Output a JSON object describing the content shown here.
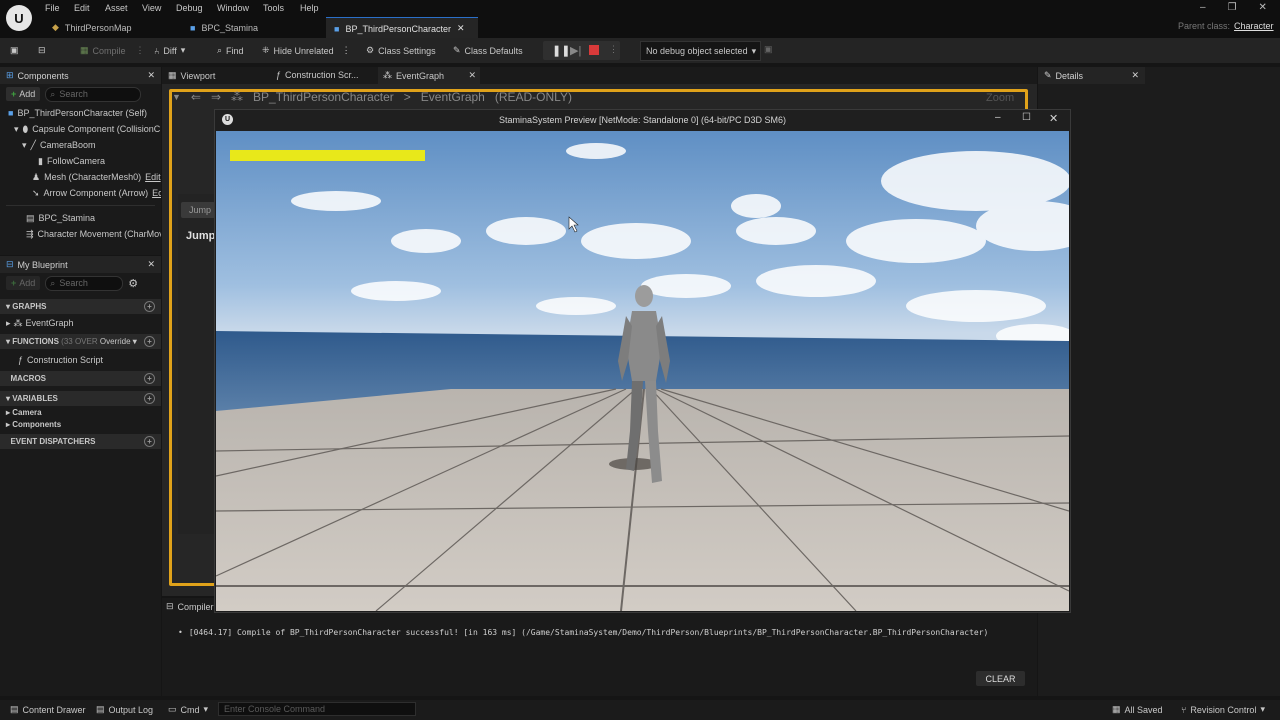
{
  "menu": {
    "file": "File",
    "edit": "Edit",
    "asset": "Asset",
    "view": "View",
    "debug": "Debug",
    "window": "Window",
    "tools": "Tools",
    "help": "Help"
  },
  "tabs": {
    "tab1": "ThirdPersonMap",
    "tab2": "BPC_Stamina",
    "tab3": "BP_ThirdPersonCharacter"
  },
  "parent_class": {
    "label": "Parent class:",
    "value": "Character"
  },
  "toolbar": {
    "compile": "Compile",
    "diff": "Diff",
    "find": "Find",
    "hide_unrelated": "Hide Unrelated",
    "class_settings": "Class Settings",
    "class_defaults": "Class Defaults",
    "debug_object": "No debug object selected"
  },
  "components": {
    "title": "Components",
    "add": "Add",
    "search_placeholder": "Search",
    "items": [
      "BP_ThirdPersonCharacter (Self)",
      "Capsule Component (CollisionC",
      "CameraBoom",
      "FollowCamera",
      "Mesh (CharacterMesh0)",
      "Arrow Component (Arrow)",
      "BPC_Stamina",
      "Character Movement (CharMov"
    ],
    "edit_suffix": "Edit",
    "edit_suffix2": "Ec"
  },
  "my_blueprint": {
    "title": "My Blueprint",
    "add": "Add",
    "search_placeholder": "Search",
    "graphs": "GRAPHS",
    "event_graph": "EventGraph",
    "functions": "FUNCTIONS",
    "functions_count": "(33 OVER",
    "override": "Override",
    "construction_script": "Construction Script",
    "macros": "MACROS",
    "variables": "VARIABLES",
    "camera": "Camera",
    "components": "Components",
    "event_dispatchers": "EVENT DISPATCHERS"
  },
  "center_tabs": {
    "viewport": "Viewport",
    "construction": "Construction Scr...",
    "event_graph": "EventGraph"
  },
  "graph": {
    "breadcrumb_root": "BP_ThirdPersonCharacter",
    "breadcrumb_sep": ">",
    "breadcrumb_leaf": "EventGraph",
    "readonly": "(READ-ONLY)",
    "zoom": "Zoom",
    "jump_node": "Jump",
    "jump_label": "Jump"
  },
  "preview": {
    "title": "StaminaSystem Preview [NetMode: Standalone 0]  (64-bit/PC D3D SM6)",
    "stamina_fill": 1.0,
    "stamina_color": "#e8e81a"
  },
  "details": {
    "title": "Details"
  },
  "compiler": {
    "tab": "Compiler",
    "log": "[0464.17] Compile of BP_ThirdPersonCharacter successful! [in 163 ms] (/Game/StaminaSystem/Demo/ThirdPerson/Blueprints/BP_ThirdPersonCharacter.BP_ThirdPersonCharacter)",
    "clear": "CLEAR"
  },
  "statusbar": {
    "content_drawer": "Content Drawer",
    "output_log": "Output Log",
    "cmd": "Cmd",
    "console_placeholder": "Enter Console Command",
    "all_saved": "All Saved",
    "revision_control": "Revision Control"
  },
  "colors": {
    "accent": "#2a6fc9",
    "graph_border": "#e0a21a",
    "add_green": "#3fa33f"
  }
}
